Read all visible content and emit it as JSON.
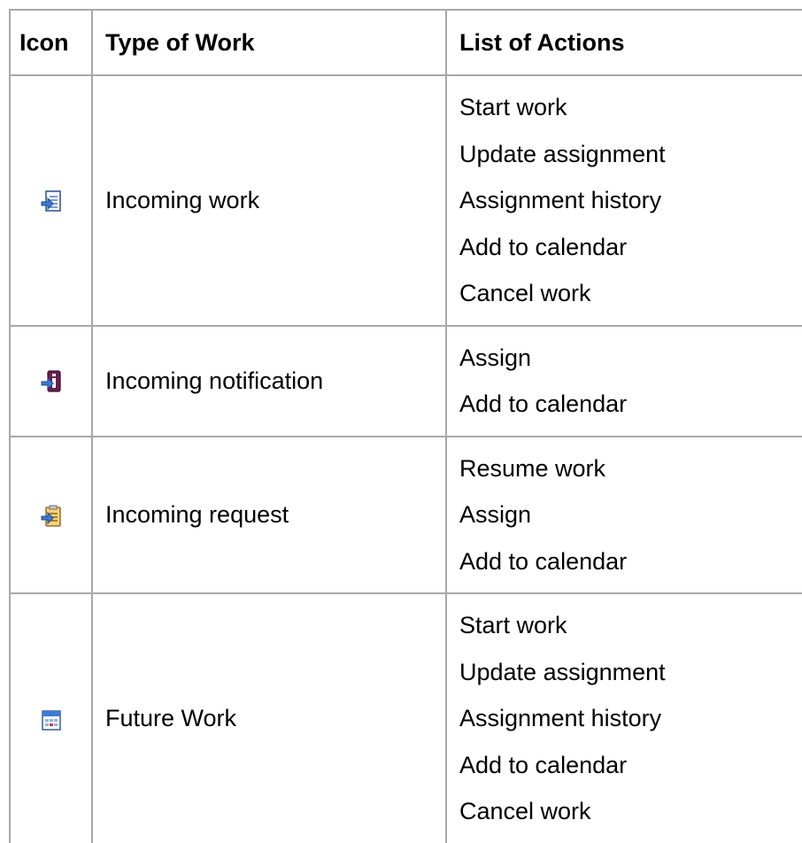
{
  "headers": {
    "icon": "Icon",
    "type": "Type of Work",
    "actions": "List of Actions"
  },
  "rows": [
    {
      "icon": "incoming-work-icon",
      "type": "Incoming work",
      "actions": [
        "Start work",
        "Update assignment",
        "Assignment history",
        "Add to calendar",
        "Cancel work"
      ]
    },
    {
      "icon": "incoming-notification-icon",
      "type": "Incoming notification",
      "actions": [
        "Assign",
        "Add to calendar"
      ]
    },
    {
      "icon": "incoming-request-icon",
      "type": "Incoming request",
      "actions": [
        "Resume work",
        "Assign",
        "Add to calendar"
      ]
    },
    {
      "icon": "future-work-icon",
      "type": "Future Work",
      "actions": [
        "Start work",
        "Update assignment",
        "Assignment history",
        "Add to calendar",
        "Cancel work"
      ]
    }
  ]
}
